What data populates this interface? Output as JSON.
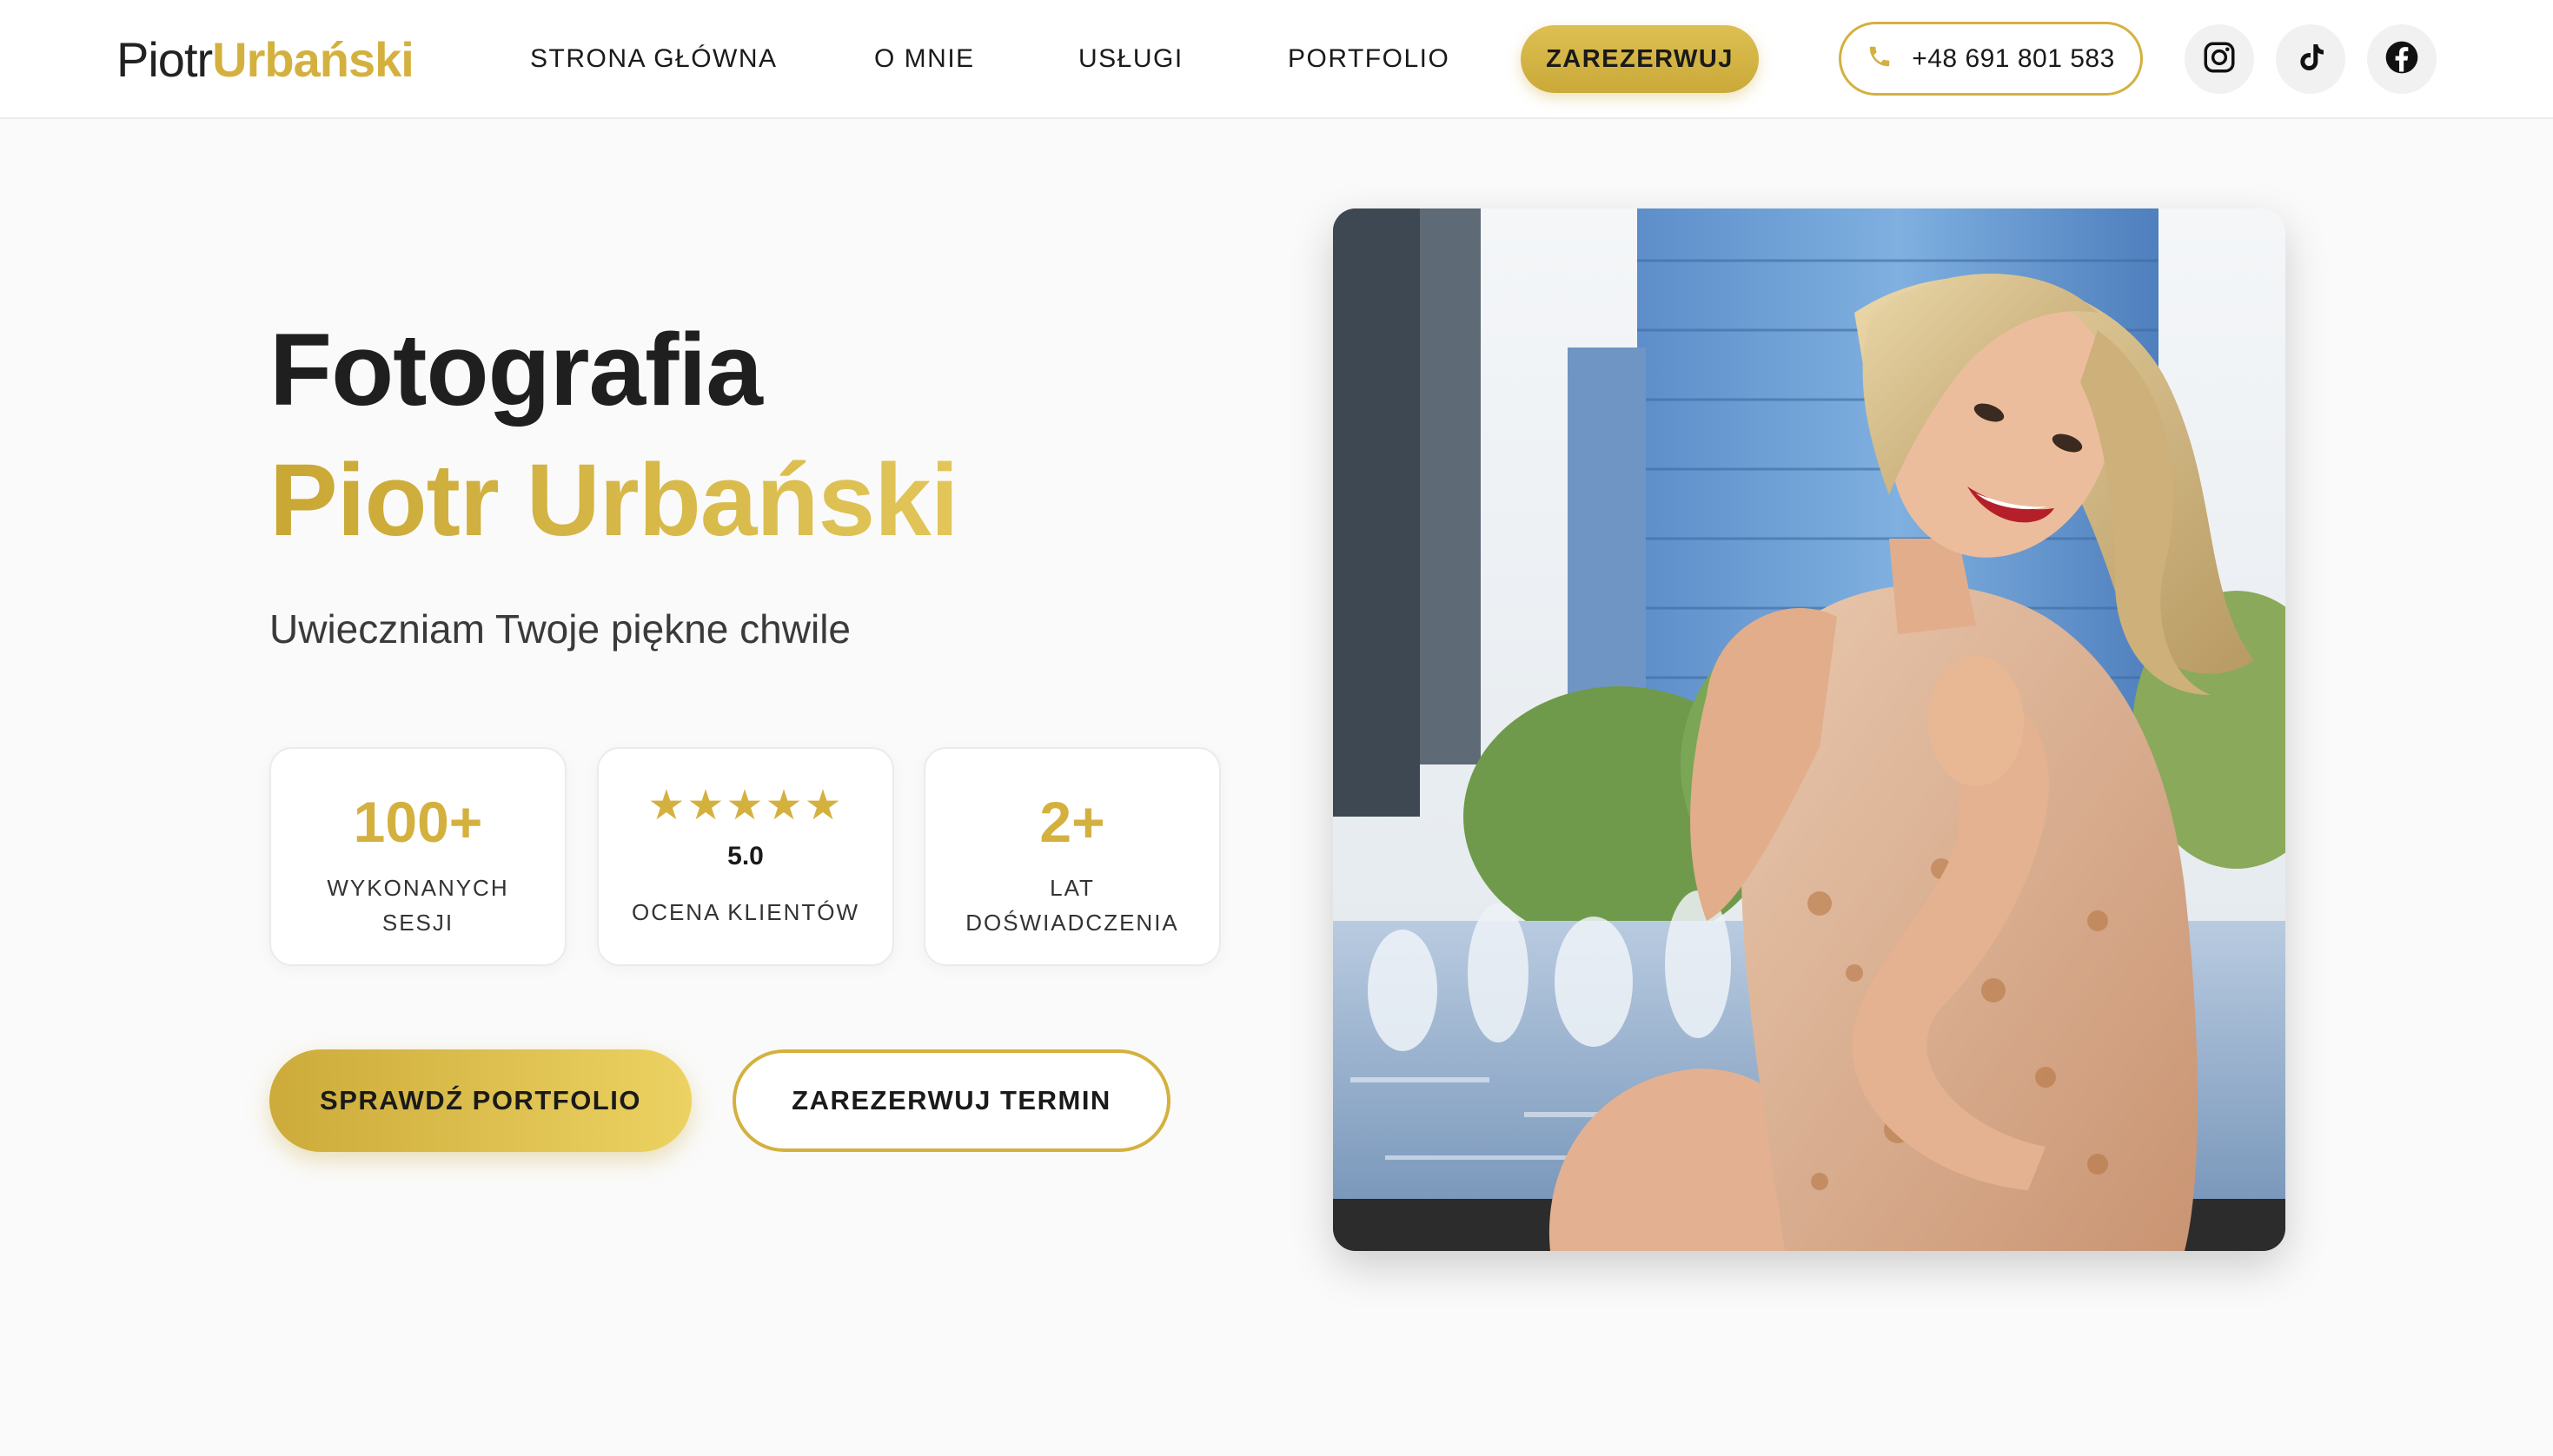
{
  "header": {
    "logo_first": "Piotr",
    "logo_last": "Urbański",
    "nav": [
      {
        "label": "STRONA GŁÓWNA"
      },
      {
        "label": "O MNIE"
      },
      {
        "label": "USŁUGI"
      },
      {
        "label": "PORTFOLIO"
      }
    ],
    "cta_label": "ZAREZERWUJ",
    "phone": "+48 691 801 583",
    "social": [
      {
        "icon": "instagram-icon"
      },
      {
        "icon": "tiktok-icon"
      },
      {
        "icon": "facebook-icon"
      }
    ]
  },
  "hero": {
    "title": "Fotografia",
    "name": "Piotr Urbański",
    "subtitle": "Uwieczniam Twoje piękne chwile",
    "stats": [
      {
        "value": "100+",
        "label": "WYKONANYCH SESJI"
      },
      {
        "stars": "★★★★★",
        "rating": "5.0",
        "label": "OCENA KLIENTÓW"
      },
      {
        "value": "2+",
        "label": "LAT DOŚWIADCZENIA"
      }
    ],
    "primary_button": "SPRAWDŹ PORTFOLIO",
    "secondary_button": "ZAREZERWUJ TERMIN"
  },
  "colors": {
    "accent": "#d4b13f",
    "background": "#fafafa",
    "text": "#1a1a1a"
  }
}
